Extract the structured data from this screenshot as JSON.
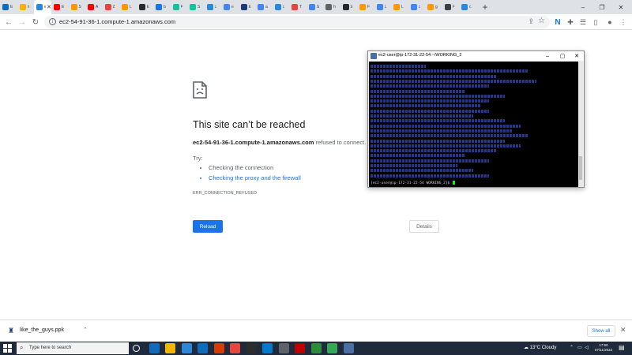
{
  "browser": {
    "tabs": [
      {
        "icon": "outlook-icon",
        "label": "E",
        "color": "#0f6cbd"
      },
      {
        "icon": "app-icon",
        "label": "h",
        "color": "#f4b400"
      },
      {
        "icon": "edge-icon",
        "label": "e",
        "color": "#2b88d8",
        "active": true
      },
      {
        "icon": "youtube-icon",
        "label": "E",
        "color": "#ff0000"
      },
      {
        "icon": "aws-icon",
        "label": "S",
        "color": "#ff9900"
      },
      {
        "icon": "youtube-icon",
        "label": "A",
        "color": "#ff0000"
      },
      {
        "icon": "app-icon",
        "label": "Z",
        "color": "#e8453c"
      },
      {
        "icon": "aws-icon",
        "label": "L",
        "color": "#ff9900"
      },
      {
        "icon": "github-icon",
        "label": "E",
        "color": "#24292e"
      },
      {
        "icon": "app-icon",
        "label": "b",
        "color": "#1a73e8"
      },
      {
        "icon": "grammarly-icon",
        "label": "F",
        "color": "#15c39a"
      },
      {
        "icon": "grammarly-icon",
        "label": "S",
        "color": "#15c39a"
      },
      {
        "icon": "edge-icon",
        "label": "c",
        "color": "#2b88d8"
      },
      {
        "icon": "google-icon",
        "label": "e",
        "color": "#4285f4"
      },
      {
        "icon": "app-icon",
        "label": "E",
        "color": "#1a3a7a"
      },
      {
        "icon": "google-icon",
        "label": "a",
        "color": "#4285f4"
      },
      {
        "icon": "edge-icon",
        "label": "c",
        "color": "#2b88d8"
      },
      {
        "icon": "app-icon",
        "label": "T",
        "color": "#e8453c"
      },
      {
        "icon": "google-icon",
        "label": "G",
        "color": "#4285f4"
      },
      {
        "icon": "app-icon",
        "label": "h",
        "color": "#5f6368"
      },
      {
        "icon": "github-icon",
        "label": "b",
        "color": "#24292e"
      },
      {
        "icon": "aws-icon",
        "label": "F",
        "color": "#ff9900"
      },
      {
        "icon": "google-icon",
        "label": "L",
        "color": "#4285f4"
      },
      {
        "icon": "aws-icon",
        "label": "L",
        "color": "#ff9900"
      },
      {
        "icon": "google-icon",
        "label": "c",
        "color": "#4285f4"
      },
      {
        "icon": "aws-icon",
        "label": "g",
        "color": "#ff9900"
      },
      {
        "icon": "app-icon",
        "label": "F",
        "color": "#3c4043"
      },
      {
        "icon": "edge-icon",
        "label": "c",
        "color": "#2b88d8"
      }
    ],
    "new_tab": "+",
    "url": "ec2-54-91-36-1.compute-1.amazonaws.com"
  },
  "error_page": {
    "title": "This site can’t be reached",
    "host": "ec2-54-91-36-1.compute-1.amazonaws.com",
    "message_suffix": " refused to connect.",
    "try_label": "Try:",
    "suggestions": [
      "Checking the connection",
      "Checking the proxy and the firewall"
    ],
    "error_code": "ERR_CONNECTION_REFUSED",
    "reload_label": "Reload",
    "details_label": "Details"
  },
  "terminal": {
    "title": "ec2-user@ip-172-31-22-54:~/WORKING_2",
    "prompt": "[ec2-user@ip-172-31-22-54 WORKING_2]$ "
  },
  "downloads": {
    "file_name": "like_the_guys.ppk",
    "show_all": "Show all"
  },
  "taskbar": {
    "search_placeholder": "Type here to search",
    "weather": "13°C  Cloudy",
    "time": "17:50",
    "date": "07/11/2022",
    "apps": [
      {
        "icon": "task-view-icon",
        "color": "transparent"
      },
      {
        "icon": "edge-icon",
        "color": "#0f6cbd"
      },
      {
        "icon": "file-explorer-icon",
        "color": "#f4b400"
      },
      {
        "icon": "store-icon",
        "color": "#2b88d8"
      },
      {
        "icon": "mail-icon",
        "color": "#0f6cbd"
      },
      {
        "icon": "office-icon",
        "color": "#d83b01"
      },
      {
        "icon": "chrome-icon",
        "color": "#e8453c"
      },
      {
        "icon": "terminal-icon",
        "color": "#2d2d2d"
      },
      {
        "icon": "vscode-icon",
        "color": "#007acc"
      },
      {
        "icon": "browser-icon",
        "color": "#5f6368"
      },
      {
        "icon": "filezilla-icon",
        "color": "#bf0000"
      },
      {
        "icon": "app-icon",
        "color": "#2d8c3c"
      },
      {
        "icon": "app-icon",
        "color": "#34a853"
      },
      {
        "icon": "putty-icon",
        "color": "#4a6fa5"
      }
    ]
  }
}
